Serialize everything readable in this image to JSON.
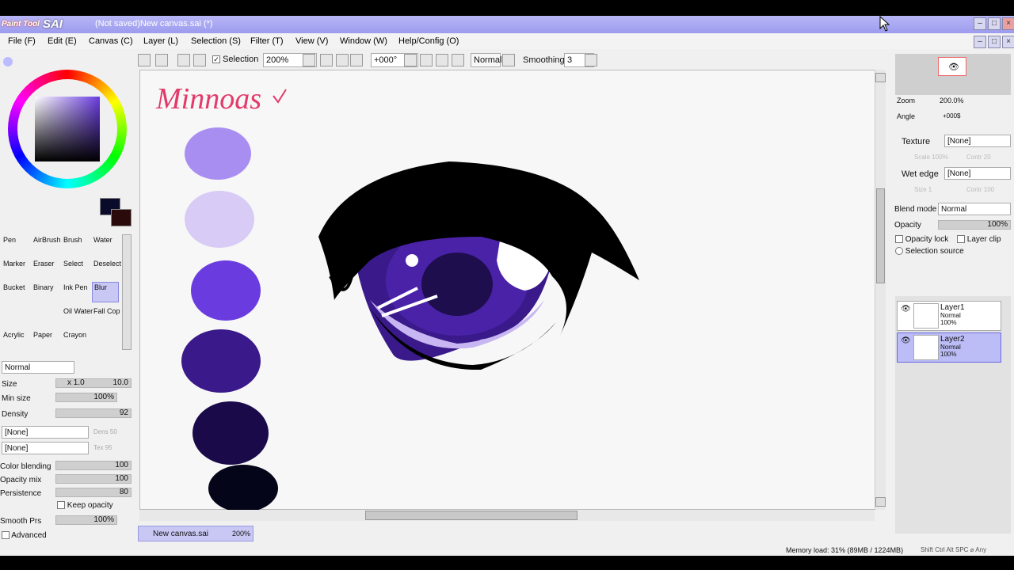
{
  "window": {
    "logo_small": "Paint Tool",
    "logo_big": "SAI",
    "title": "(Not saved)New canvas.sai (*)"
  },
  "menu": [
    "File (F)",
    "Edit (E)",
    "Canvas (C)",
    "Layer (L)",
    "Selection (S)",
    "Filter (T)",
    "View (V)",
    "Window (W)",
    "Help/Config (O)"
  ],
  "toolbar": {
    "selection_label": "Selection",
    "selection_checked": true,
    "zoom": "200%",
    "angle": "+000°",
    "mode": "Normal",
    "smoothing_label": "Smoothing",
    "smoothing_value": "3"
  },
  "colors": {
    "fg": "#0a0a2a",
    "bg": "#2a0a0a",
    "accent": "#b7b6f6",
    "palette": [
      "#a98ef2",
      "#d8cbf5",
      "#6a3ce0",
      "#3a1a8a",
      "#1a0a4a",
      "#05051a"
    ]
  },
  "tools": {
    "row1": [
      "Pen",
      "AirBrush",
      "Brush",
      "Water"
    ],
    "row2": [
      "Marker",
      "Eraser",
      "Select",
      "Deselect"
    ],
    "row3": [
      "Bucket",
      "Binary",
      "Ink Pen",
      "Blur"
    ],
    "row4": [
      "",
      "",
      "Oil Water",
      "Fall Cop"
    ],
    "row5": [
      "Acrylic",
      "Paper",
      "Crayon",
      ""
    ]
  },
  "brush": {
    "mode": "Normal",
    "size_label": "Size",
    "size_mult": "x 1.0",
    "size_value": "10.0",
    "min_size_label": "Min size",
    "min_size_value": "100%",
    "density_label": "Density",
    "density_value": "92",
    "shape": "[None]",
    "texture": "[None]",
    "shape_strength": "Dens 50",
    "texture_strength": "Tex 95",
    "color_blending_label": "Color blending",
    "color_blending_value": "100",
    "opacity_mix_label": "Opacity mix",
    "opacity_mix_value": "100",
    "persistence_label": "Persistence",
    "persistence_value": "80",
    "keep_opacity_label": "Keep opacity",
    "smooth_prs_label": "Smooth Prs",
    "smooth_prs_value": "100%",
    "advanced_label": "Advanced"
  },
  "canvas_text": "Minnoas",
  "navigator": {
    "zoom_label": "Zoom",
    "zoom_value": "200.0%",
    "angle_label": "Angle",
    "angle_value": "+000$"
  },
  "layer_props": {
    "texture_label": "Texture",
    "texture_value": "[None]",
    "texture_scale": "Scale 100%",
    "texture_contrast": "Contr 20",
    "wet_edge_label": "Wet edge",
    "wet_edge_value": "[None]",
    "wet_edge_size": "Size 1",
    "wet_edge_contrast": "Contr 100",
    "blend_mode_label": "Blend mode",
    "blend_mode_value": "Normal",
    "opacity_label": "Opacity",
    "opacity_value": "100%",
    "opacity_lock_label": "Opacity lock",
    "layer_clip_label": "Layer clip",
    "selection_source_label": "Selection source"
  },
  "layers": [
    {
      "name": "Layer1",
      "mode": "Normal",
      "opacity": "100%",
      "selected": false
    },
    {
      "name": "Layer2",
      "mode": "Normal",
      "opacity": "100%",
      "selected": true
    }
  ],
  "doc_tab": {
    "name": "New canvas.sai",
    "zoom": "200%"
  },
  "status": {
    "memory": "Memory load: 31% (89MB / 1224MB)",
    "keys": "Shift Ctrl Alt SPC ⌀ Any"
  }
}
